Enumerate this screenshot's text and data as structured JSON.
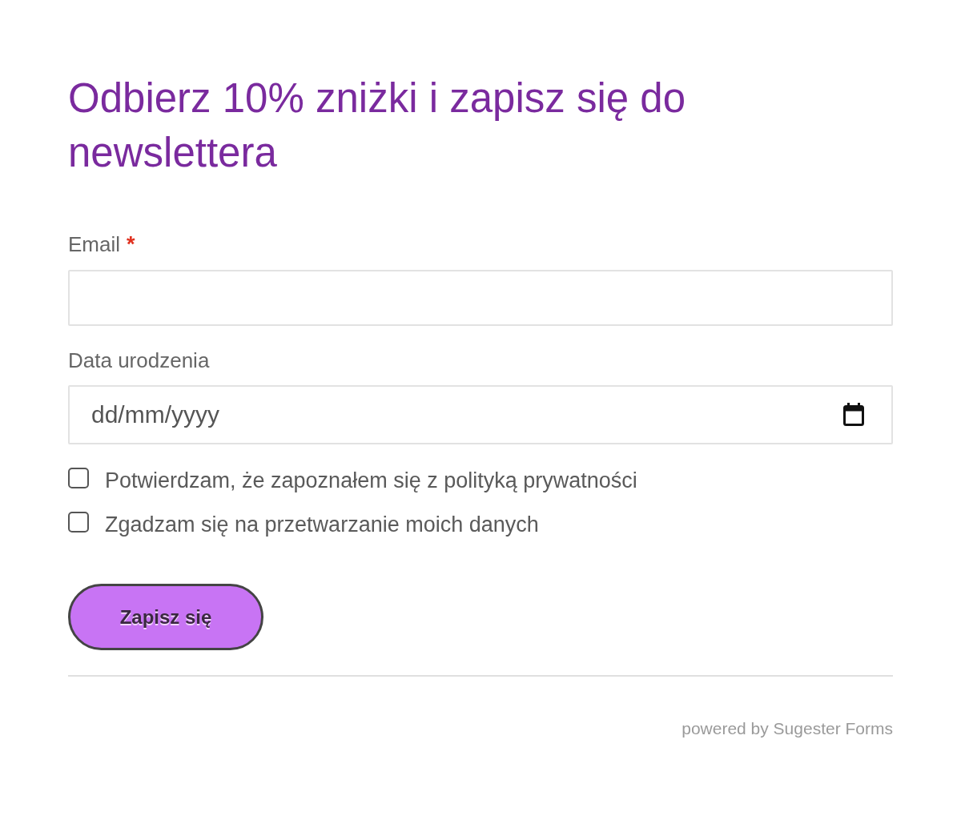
{
  "heading": "Odbierz 10% zniżki i zapisz się do newslettera",
  "fields": [
    {
      "kind": "text",
      "label": "Email",
      "required_mark": "*"
    },
    {
      "kind": "date",
      "label": "Data urodzenia",
      "placeholder": "dd/mm/yyyy"
    }
  ],
  "checkboxes": [
    {
      "label": "Potwierdzam, że zapoznałem się z polityką prywatności",
      "checked": false
    },
    {
      "label": "Zgadzam się na przetwarzanie moich danych",
      "checked": false
    }
  ],
  "submit_button": {
    "label": "Zapisz się"
  },
  "footer": {
    "text": "powered by Sugester Forms"
  }
}
